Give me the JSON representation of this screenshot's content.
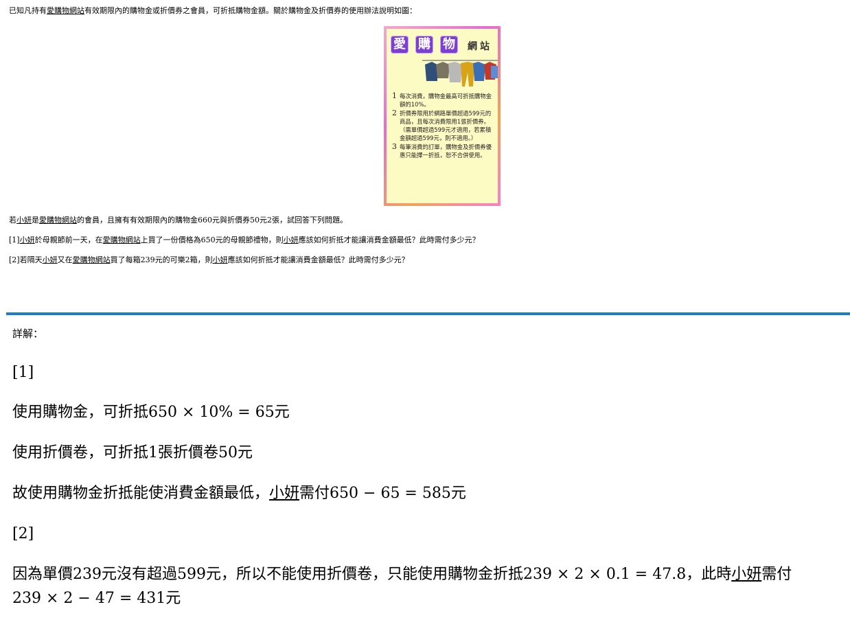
{
  "problem": {
    "intro": {
      "pre": "已知凡持有",
      "site": "愛購物網站",
      "post": "有效期限內的購物金或折價券之會員，可折抵購物金額。關於購物金及折價券的使用辦法說明如圖："
    },
    "setup": {
      "pre": "若",
      "name": "小妍",
      "mid": "是",
      "site": "愛購物網站",
      "post": "的會員，且擁有有效期限內的購物金660元與折價券50元2張，試回答下列問題。"
    },
    "q1": {
      "a": "[1]",
      "name1": "小妍",
      "b": "於母親節前一天，在",
      "site": "愛購物網站",
      "c": "上買了一份價格為650元的母親節禮物，則",
      "name2": "小妍",
      "d": "應該如何折抵才能讓消費金額最低？此時需付多少元？"
    },
    "q2": {
      "a": "[2]若隔天",
      "name1": "小妍",
      "b": "又在",
      "site": "愛購物網站",
      "c": "買了每箱239元的可樂2箱，則",
      "name2": "小妍",
      "d": "應該如何折抵才能讓消費金額最低？此時需付多少元？"
    }
  },
  "poster": {
    "logo": [
      "愛",
      "購",
      "物"
    ],
    "site_label": "網站",
    "rules": [
      {
        "num": "1",
        "text": "每次消費，購物金最高可折抵購物金額的10%。"
      },
      {
        "num": "2",
        "text": "折價券限用於網路單價超過599元的商品，且每次消費限用1張折價券。（需單價超過599元才適用，若累積金額超過599元，則不適用。）"
      },
      {
        "num": "3",
        "text": "每筆消費的訂單，購物金及折價券優惠只能擇一折抵，恕不合併使用。"
      }
    ]
  },
  "solution": {
    "heading": "詳解：",
    "part1_label": "[1]",
    "line1": "使用購物金，可折抵650 × 10% = 65元",
    "line2": "使用折價卷，可折抵1張折價卷50元",
    "line3_pre": "故使用購物金折抵能使消費金額最低，",
    "line3_name": "小妍",
    "line3_post": "需付650 − 65 = 585元",
    "part2_label": "[2]",
    "line4_pre": "因為單價239元沒有超過599元，所以不能使用折價卷，只能使用購物金折抵239 × 2 × 0.1 = 47.8，此時",
    "line4_name": "小妍",
    "line4_post": "需付",
    "line5": "239 × 2 − 47 = 431元"
  },
  "colors": {
    "divider": "#1a7fc8",
    "logo_bg": "#7c3fd1",
    "poster_bg": "#fdfbc4"
  }
}
